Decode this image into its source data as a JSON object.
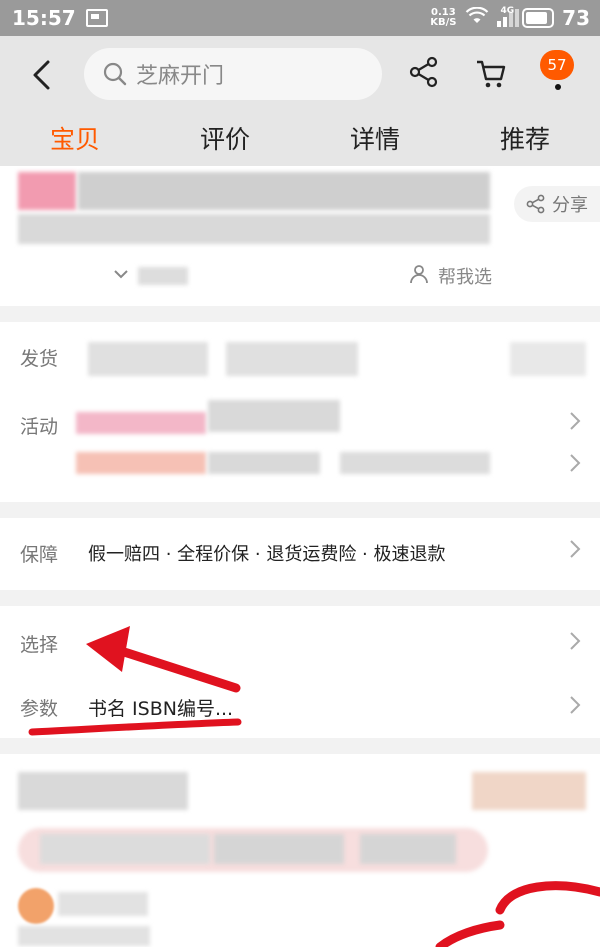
{
  "status_bar": {
    "time": "15:57",
    "net_speed_value": "0.13",
    "net_speed_unit": "KB/S",
    "network_type": "4G",
    "battery_level": "73"
  },
  "header": {
    "search_placeholder": "芝麻开门",
    "cart_badge_count": "57",
    "tabs": [
      {
        "label": "宝贝",
        "active": true
      },
      {
        "label": "评价",
        "active": false
      },
      {
        "label": "详情",
        "active": false
      },
      {
        "label": "推荐",
        "active": false
      }
    ]
  },
  "product": {
    "share_label": "分享",
    "help_choose_label": "帮我选"
  },
  "rows": {
    "shipping_label": "发货",
    "activity_label": "活动",
    "guarantee_label": "保障",
    "guarantee_value": "假一赔四 · 全程价保 · 退货运费险 · 极速退款",
    "select_label": "选择",
    "params_label": "参数",
    "params_value": "书名 ISBN编号..."
  },
  "colors": {
    "accent": "#ff5a00",
    "annotation_red": "#e0121f",
    "header_bg": "#e6e6e6",
    "status_bg": "#9a9a9a"
  }
}
